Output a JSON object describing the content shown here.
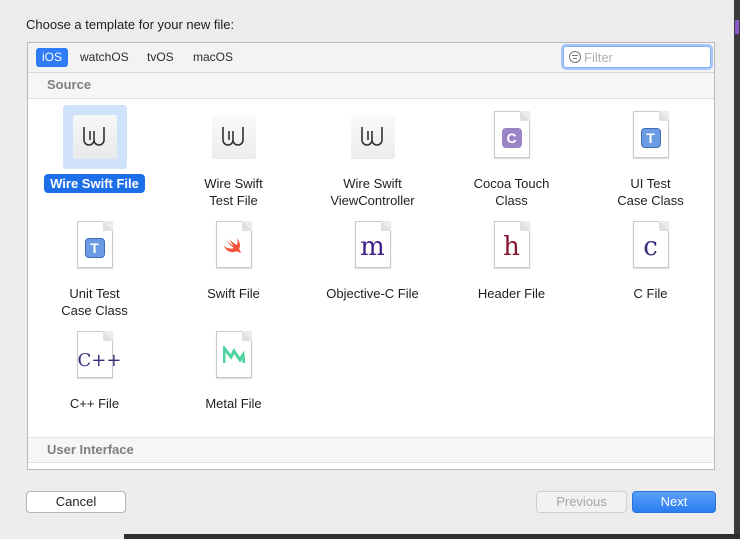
{
  "dialog": {
    "title": "Choose a template for your new file:"
  },
  "tabs": [
    {
      "label": "iOS",
      "active": true
    },
    {
      "label": "watchOS",
      "active": false
    },
    {
      "label": "tvOS",
      "active": false
    },
    {
      "label": "macOS",
      "active": false
    }
  ],
  "filter": {
    "value": "",
    "placeholder": "Filter"
  },
  "sections": {
    "source": "Source",
    "user_interface": "User Interface"
  },
  "templates": [
    {
      "label": "Wire Swift File",
      "icon": "wire-icon",
      "selected": true
    },
    {
      "label": "Wire Swift\nTest File",
      "icon": "wire-icon"
    },
    {
      "label": "Wire Swift\nViewController",
      "icon": "wire-icon"
    },
    {
      "label": "Cocoa Touch\nClass",
      "icon": "cocoa-class-icon",
      "glyph": "C"
    },
    {
      "label": "UI Test\nCase Class",
      "icon": "test-case-icon",
      "glyph": "T"
    },
    {
      "label": "Unit Test\nCase Class",
      "icon": "test-case-icon",
      "glyph": "T"
    },
    {
      "label": "Swift File",
      "icon": "swift-file-icon"
    },
    {
      "label": "Objective-C File",
      "icon": "objc-file-icon",
      "glyph": "m"
    },
    {
      "label": "Header File",
      "icon": "header-file-icon",
      "glyph": "h"
    },
    {
      "label": "C File",
      "icon": "c-file-icon",
      "glyph": "c"
    },
    {
      "label": "C++ File",
      "icon": "cpp-file-icon",
      "glyph": "C++"
    },
    {
      "label": "Metal File",
      "icon": "metal-file-icon"
    }
  ],
  "buttons": {
    "cancel": "Cancel",
    "previous": "Previous",
    "next": "Next"
  },
  "colors": {
    "accent": "#2f7cf6",
    "selection": "#1c6fe8",
    "objc": "#3a1f8a",
    "header": "#8a1533",
    "c": "#3c2a78",
    "swift": "#f05138",
    "metal": "#4fd3a0"
  }
}
